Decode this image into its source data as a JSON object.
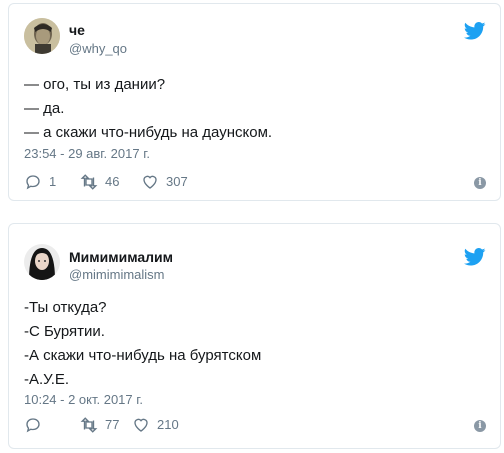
{
  "tweets": [
    {
      "name": "че",
      "handle": "@why_qo",
      "lines": [
        "— ого, ты из дании?",
        "— да.",
        "— а скажи что-нибудь на даунском."
      ],
      "timestamp": "23:54 - 29 авг. 2017 г.",
      "replies": "1",
      "retweets": "46",
      "likes": "307"
    },
    {
      "name": "Мимимималим",
      "handle": "@mimimimalism",
      "lines": [
        "-Ты откуда?",
        "-С Бурятии.",
        "-А скажи что-нибудь на бурятском",
        "-А.У.Е."
      ],
      "timestamp": "10:24 - 2 окт. 2017 г.",
      "replies": "",
      "retweets": "77",
      "likes": "210"
    }
  ],
  "colors": {
    "twitter_blue": "#1da1f2",
    "secondary_text": "#657786",
    "border": "#e1e8ed"
  },
  "icons": [
    "twitter-bird-icon",
    "reply-icon",
    "retweet-icon",
    "like-icon",
    "info-icon"
  ]
}
